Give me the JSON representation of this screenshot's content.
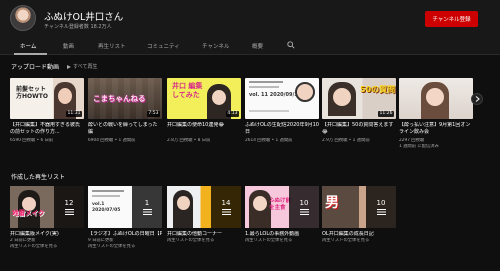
{
  "channel": {
    "name": "ふぬけOL井口さん",
    "subscribers": "チャンネル登録者数 18.2万人",
    "subscribe_label": "チャンネル登録"
  },
  "tabs": [
    "ホーム",
    "動画",
    "再生リスト",
    "コミュニティ",
    "チャンネル",
    "概要"
  ],
  "uploads": {
    "title": "アップロード動画",
    "play_all": "すべて再生",
    "videos": [
      {
        "title": "【井口編集】不器用すぎる彼氏の前セットの作り方...",
        "duration": "11:31",
        "views": "6590 回視聴",
        "ago": "6 日前",
        "thumb_text": "前髪セット 方HOWTO"
      },
      {
        "title": "酔いとの戦いを繰ってしまった編",
        "duration": "7:53",
        "views": "6904 回視聴",
        "ago": "1 週間前",
        "thumb_text": "こまちゃんねる"
      },
      {
        "title": "井口編集の使命10連発😂",
        "duration": "4:13",
        "views": "2.8万 回視聴",
        "ago": "8 日前",
        "thumb_text": "井口 編集 してみた"
      },
      {
        "title": "ふぬけOLの生配信2020年9月10日",
        "duration": "",
        "views": "2614 回視聴",
        "ago": "1 週間前",
        "thumb_text": "vol. 11 2020/09/10"
      },
      {
        "title": "【井口編集】50の質問答えます😂",
        "duration": "11:26",
        "views": "2.9万 回視聴",
        "ago": "1 週間前",
        "thumb_text": "50の質問"
      },
      {
        "title": "【酔っ払い注意】9月第1回オンライン飲み会",
        "duration": "",
        "views": "2297 回視聴",
        "ago": "1 週間前 に配信済み",
        "thumb_text": ""
      }
    ]
  },
  "playlists": {
    "title": "作成した再生リスト",
    "items": [
      {
        "title": "井口編集版メイク(実)",
        "count": "12",
        "updated": "2 日前に更新",
        "link": "再生リストの全体を見る",
        "thumb_text": "地雷メイク"
      },
      {
        "title": "【ラジオ】ふぬけOLの日曜日【PMからっ】【メインバー...",
        "count": "1",
        "updated": "9 日前に更新",
        "link": "再生リストの全体を見る",
        "thumb_text": "vol.1 2020/07/05"
      },
      {
        "title": "井口編集の他動コーナー",
        "count": "14",
        "updated": "",
        "link": "再生リストの全体を見る",
        "thumb_text": ""
      },
      {
        "title": "1.最らLOLの事務外動画",
        "count": "10",
        "updated": "",
        "link": "再生リストの全体を見る",
        "thumb_text": "ふぬけ前を主食"
      },
      {
        "title": "OL井口編集の成長日記",
        "count": "10",
        "updated": "",
        "link": "再生リストの全体を見る",
        "thumb_text": "男"
      }
    ]
  }
}
